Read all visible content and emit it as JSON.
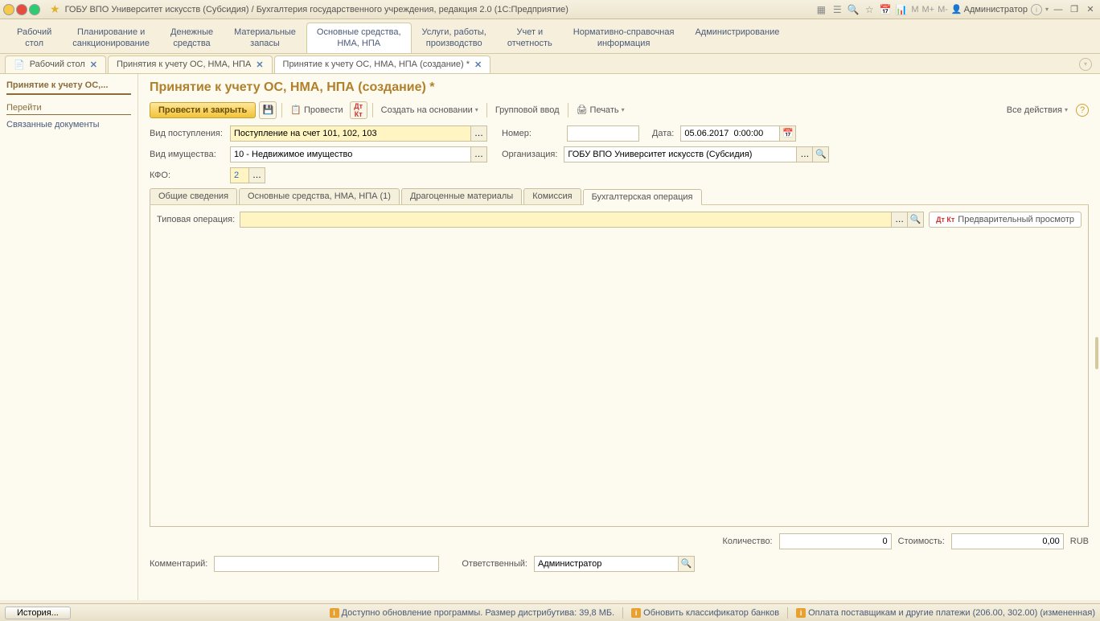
{
  "titlebar": {
    "title": "ГОБУ ВПО Университет искусств (Субсидия) / Бухгалтерия государственного учреждения, редакция 2.0  (1С:Предприятие)",
    "admin": "Администратор",
    "m": "M",
    "mplus": "M+",
    "mminus": "M-"
  },
  "ribbon": [
    "Рабочий\nстол",
    "Планирование и\nсанкционирование",
    "Денежные\nсредства",
    "Материальные\nзапасы",
    "Основные средства,\nНМА, НПА",
    "Услуги, работы,\nпроизводство",
    "Учет и\nотчетность",
    "Нормативно-справочная\nинформация",
    "Администрирование"
  ],
  "docTabs": {
    "t0": "Рабочий стол",
    "t1": "Принятия к учету ОС, НМА, НПА",
    "t2": "Принятие к учету ОС, НМА, НПА (создание) *"
  },
  "sidebar": {
    "title": "Принятие к учету ОС,...",
    "link1": "Перейти",
    "link2": "Связанные документы"
  },
  "page": {
    "title": "Принятие к учету ОС, НМА, НПА (создание) *",
    "btnMain": "Провести и закрыть",
    "btnProvesti": "Провести",
    "btnCreateBased": "Создать на основании",
    "btnGroup": "Групповой ввод",
    "btnPrint": "Печать",
    "allActions": "Все действия"
  },
  "form": {
    "vidPostLabel": "Вид поступления:",
    "vidPostVal": "Поступление на счет 101, 102, 103",
    "numLabel": "Номер:",
    "numVal": "",
    "dateLabel": "Дата:",
    "dateVal": "05.06.2017  0:00:00",
    "vidImLabel": "Вид имущества:",
    "vidImVal": "10 - Недвижимое имущество",
    "orgLabel": "Организация:",
    "orgVal": "ГОБУ ВПО Университет искусств (Субсидия)",
    "kfoLabel": "КФО:",
    "kfoVal": "2"
  },
  "innerTabs": {
    "t0": "Общие сведения",
    "t1": "Основные средства, НМА, НПА (1)",
    "t2": "Драгоценные материалы",
    "t3": "Комиссия",
    "t4": "Бухгалтерская операция"
  },
  "operation": {
    "label": "Типовая операция:",
    "val": "",
    "previewBtn": "Предварительный просмотр"
  },
  "summary": {
    "qtyLabel": "Количество:",
    "qtyVal": "0",
    "costLabel": "Стоимость:",
    "costVal": "0,00",
    "rub": "RUB"
  },
  "comment": {
    "label": "Комментарий:",
    "val": "",
    "respLabel": "Ответственный:",
    "respVal": "Администратор"
  },
  "status": {
    "history": "История...",
    "s1": "Доступно обновление программы. Размер дистрибутива: 39,8 МБ.",
    "s2": "Обновить классификатор банков",
    "s3": "Оплата поставщикам и другие платежи (206.00, 302.00) (измененная)"
  }
}
